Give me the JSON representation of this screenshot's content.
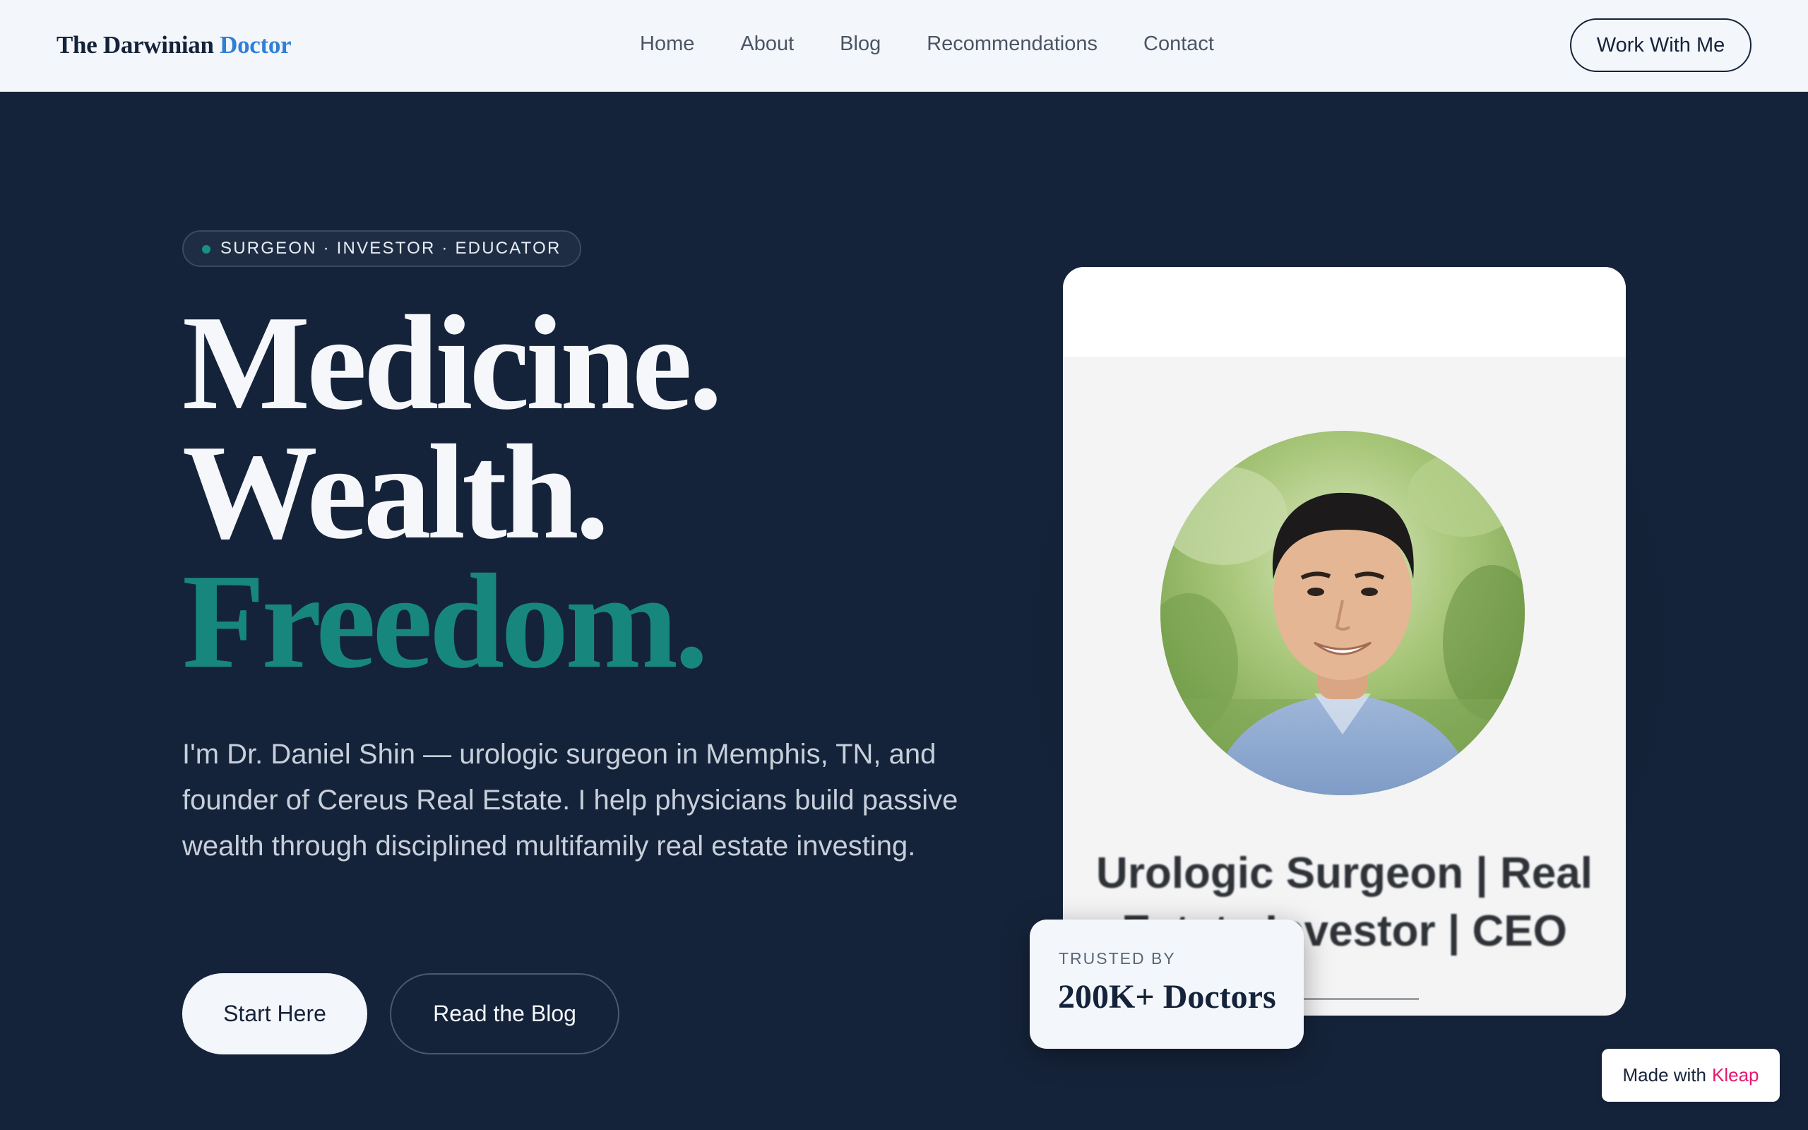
{
  "header": {
    "logo_main": "The Darwinian",
    "logo_accent": "Doctor",
    "nav": [
      "Home",
      "About",
      "Blog",
      "Recommendations",
      "Contact"
    ],
    "cta_label": "Work With Me"
  },
  "hero": {
    "eyebrow": "SURGEON · INVESTOR · EDUCATOR",
    "headline_line1": "Medicine.",
    "headline_line2": "Wealth.",
    "headline_line3": "Freedom.",
    "intro": "I'm Dr. Daniel Shin — urologic surgeon in Memphis, TN, and founder of Cereus Real Estate. I help physicians build passive wealth through disciplined multifamily real estate investing.",
    "primary_button": "Start Here",
    "secondary_button": "Read the Blog"
  },
  "profile_card": {
    "title": "Urologic Surgeon | Real Estate Investor | CEO",
    "trust_label": "TRUSTED BY",
    "trust_value": "200K+ Doctors"
  },
  "badge": {
    "prefix": "Made with",
    "brand": "Kleap"
  },
  "colors": {
    "navy": "#15233a",
    "teal": "#17877e",
    "link_blue": "#2f7fd8",
    "kleap_pink": "#e6166e"
  }
}
